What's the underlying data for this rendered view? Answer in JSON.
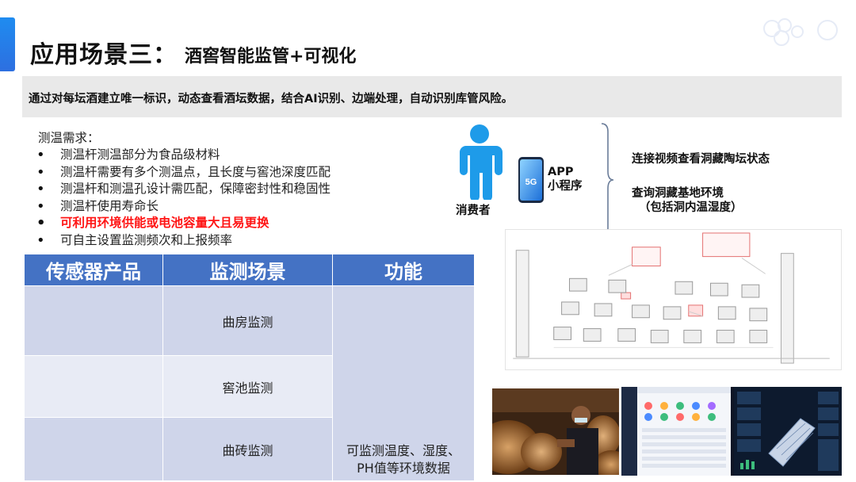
{
  "header": {
    "title": "应用场景三：",
    "subtitle": "酒窖智能监管+可视化"
  },
  "banner": {
    "text": "通过对每坛酒建立唯一标识，动态查看酒坛数据，结合AI识别、边端处理，自动识别库管风险。"
  },
  "requirements": {
    "heading": "测温需求：",
    "items": [
      {
        "text": "测温杆测温部分为食品级材料",
        "highlight": false
      },
      {
        "text": "测温杆需要有多个测温点，且长度与窖池深度匹配",
        "highlight": false
      },
      {
        "text": "测温杆和测温孔设计需匹配，保障密封性和稳固性",
        "highlight": false
      },
      {
        "text": "测温杆使用寿命长",
        "highlight": false
      },
      {
        "text": "可利用环境供能或电池容量大且易更换",
        "highlight": true
      },
      {
        "text": "可自主设置监测频次和上报频率",
        "highlight": false
      }
    ]
  },
  "table": {
    "headers": [
      "传感器产品",
      "监测场景",
      "功能"
    ],
    "rows": [
      {
        "product": "",
        "scene": "曲房监测"
      },
      {
        "product": "",
        "scene": "窖池监测"
      },
      {
        "product": "",
        "scene": "曲砖监测"
      }
    ],
    "function_line1": "可监测温度、湿度、",
    "function_line2": "PH值等环境数据"
  },
  "consumer": {
    "label": "消费者",
    "app_line1": "APP",
    "app_line2": "小程序",
    "phone_badge": "5G"
  },
  "features": {
    "line1": "连接视频查看洞藏陶坛状态",
    "line2": "查询洞藏基地环境",
    "line3": "（包括洞内温湿度）"
  },
  "colors": {
    "accent": "#2d7ff0",
    "table_header": "#4472c4",
    "table_cell": "#cfd5ea",
    "highlight": "#ff1515",
    "person_icon": "#1e9be9"
  },
  "icons": {
    "person": "person-icon",
    "phone": "phone-icon",
    "brace": "brace-icon"
  }
}
